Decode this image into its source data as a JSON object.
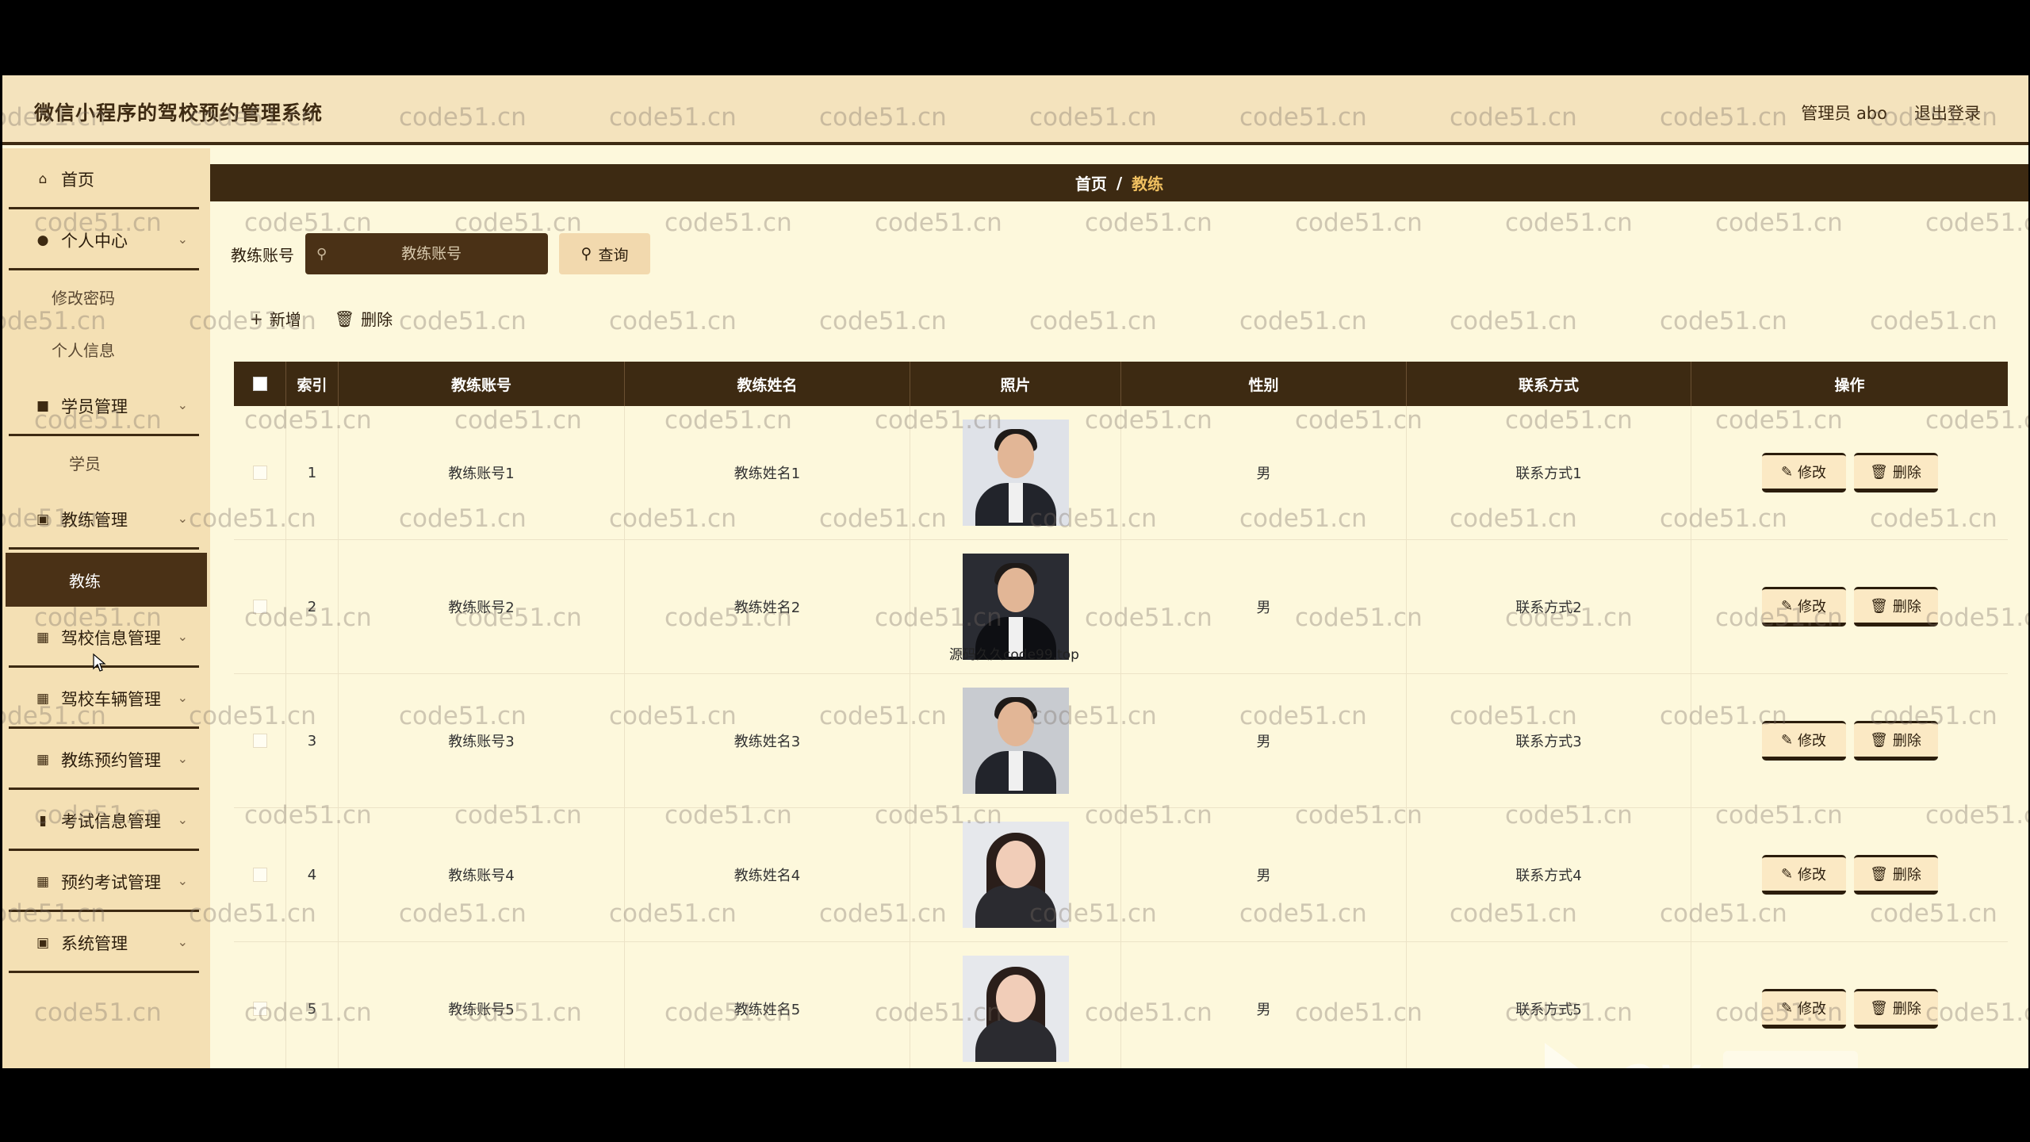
{
  "header": {
    "title": "微信小程序的驾校预约管理系统",
    "user": "管理员 abo",
    "logout": "退出登录"
  },
  "sidebar": {
    "items": [
      {
        "label": "首页",
        "icon": "home-icon"
      },
      {
        "label": "个人中心",
        "icon": "user-icon",
        "children": [
          "修改密码",
          "个人信息"
        ]
      },
      {
        "label": "学员管理",
        "icon": "briefcase-icon",
        "children": [
          "学员"
        ]
      },
      {
        "label": "教练管理",
        "icon": "clipboard-icon",
        "children": [
          "教练"
        ]
      },
      {
        "label": "驾校信息管理",
        "icon": "grid-icon"
      },
      {
        "label": "驾校车辆管理",
        "icon": "grid-icon"
      },
      {
        "label": "教练预约管理",
        "icon": "grid-icon"
      },
      {
        "label": "考试信息管理",
        "icon": "chart-icon"
      },
      {
        "label": "预约考试管理",
        "icon": "grid-icon"
      },
      {
        "label": "系统管理",
        "icon": "clipboard-icon"
      }
    ]
  },
  "breadcrumb": {
    "home": "首页",
    "separator": "/",
    "current": "教练"
  },
  "search": {
    "label": "教练账号",
    "placeholder": "教练账号",
    "button": "查询"
  },
  "actions": {
    "add": "新增",
    "delete": "删除"
  },
  "table": {
    "columns": [
      "索引",
      "教练账号",
      "教练姓名",
      "照片",
      "性别",
      "联系方式",
      "操作"
    ],
    "rows": [
      {
        "index": "1",
        "account": "教练账号1",
        "name": "教练姓名1",
        "gender": "男",
        "contact": "联系方式1",
        "photo": "male-portrait"
      },
      {
        "index": "2",
        "account": "教练账号2",
        "name": "教练姓名2",
        "gender": "男",
        "contact": "联系方式2",
        "photo": "male-portrait"
      },
      {
        "index": "3",
        "account": "教练账号3",
        "name": "教练姓名3",
        "gender": "男",
        "contact": "联系方式3",
        "photo": "male-portrait"
      },
      {
        "index": "4",
        "account": "教练账号4",
        "name": "教练姓名4",
        "gender": "男",
        "contact": "联系方式4",
        "photo": "female-portrait"
      },
      {
        "index": "5",
        "account": "教练账号5",
        "name": "教练姓名5",
        "gender": "男",
        "contact": "联系方式5",
        "photo": "female-portrait"
      }
    ],
    "edit_label": "修改",
    "delete_label": "删除"
  },
  "watermark": "code51.cn",
  "overlay_text": "源码久久code99.top",
  "colors": {
    "primary": "#3d2a12",
    "background": "#fdf8dc",
    "sidebar": "#f4e0b4",
    "accent": "#f0c060"
  }
}
